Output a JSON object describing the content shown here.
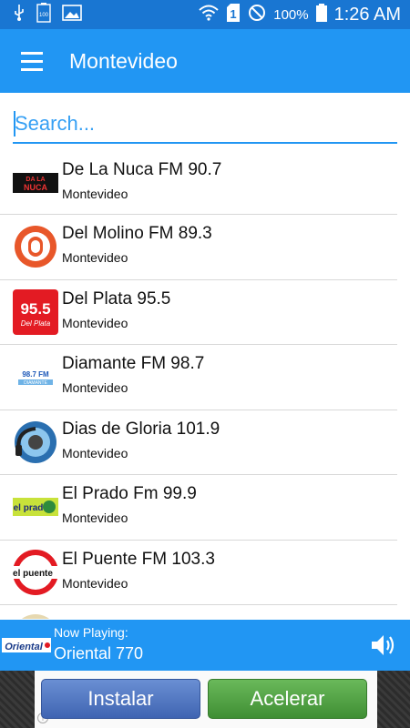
{
  "status_bar": {
    "battery_badge": "100",
    "battery_percent": "100%",
    "signal_badge": "1",
    "time": "1:26 AM"
  },
  "app_bar": {
    "title": "Montevideo"
  },
  "search": {
    "placeholder": "Search..."
  },
  "stations": [
    {
      "name": "De La Nuca FM 90.7",
      "city": "Montevideo",
      "logo_text": "DA LA NUCA"
    },
    {
      "name": "Del Molino FM 89.3",
      "city": "Montevideo",
      "logo_text": ""
    },
    {
      "name": "Del Plata 95.5",
      "city": "Montevideo",
      "logo_text": "95.5"
    },
    {
      "name": "Diamante FM 98.7",
      "city": "Montevideo",
      "logo_text": "98.7 FM"
    },
    {
      "name": "Dias de Gloria 101.9",
      "city": "Montevideo",
      "logo_text": ""
    },
    {
      "name": "El Prado Fm 99.9",
      "city": "Montevideo",
      "logo_text": "el prado"
    },
    {
      "name": "El Puente FM 103.3",
      "city": "Montevideo",
      "logo_text": "el puente"
    },
    {
      "name": "",
      "city": "",
      "logo_text": ""
    }
  ],
  "now_playing": {
    "label": "Now Playing:",
    "station": "Oriental 770",
    "logo_text": "Oriental"
  },
  "ad": {
    "install_label": "Instalar",
    "accelerate_label": "Acelerar",
    "info_label": "i"
  },
  "colors": {
    "primary": "#2196f3",
    "status_bar": "#1976d2",
    "install_button": "#4a70bf",
    "accelerate_button": "#4ea443"
  }
}
